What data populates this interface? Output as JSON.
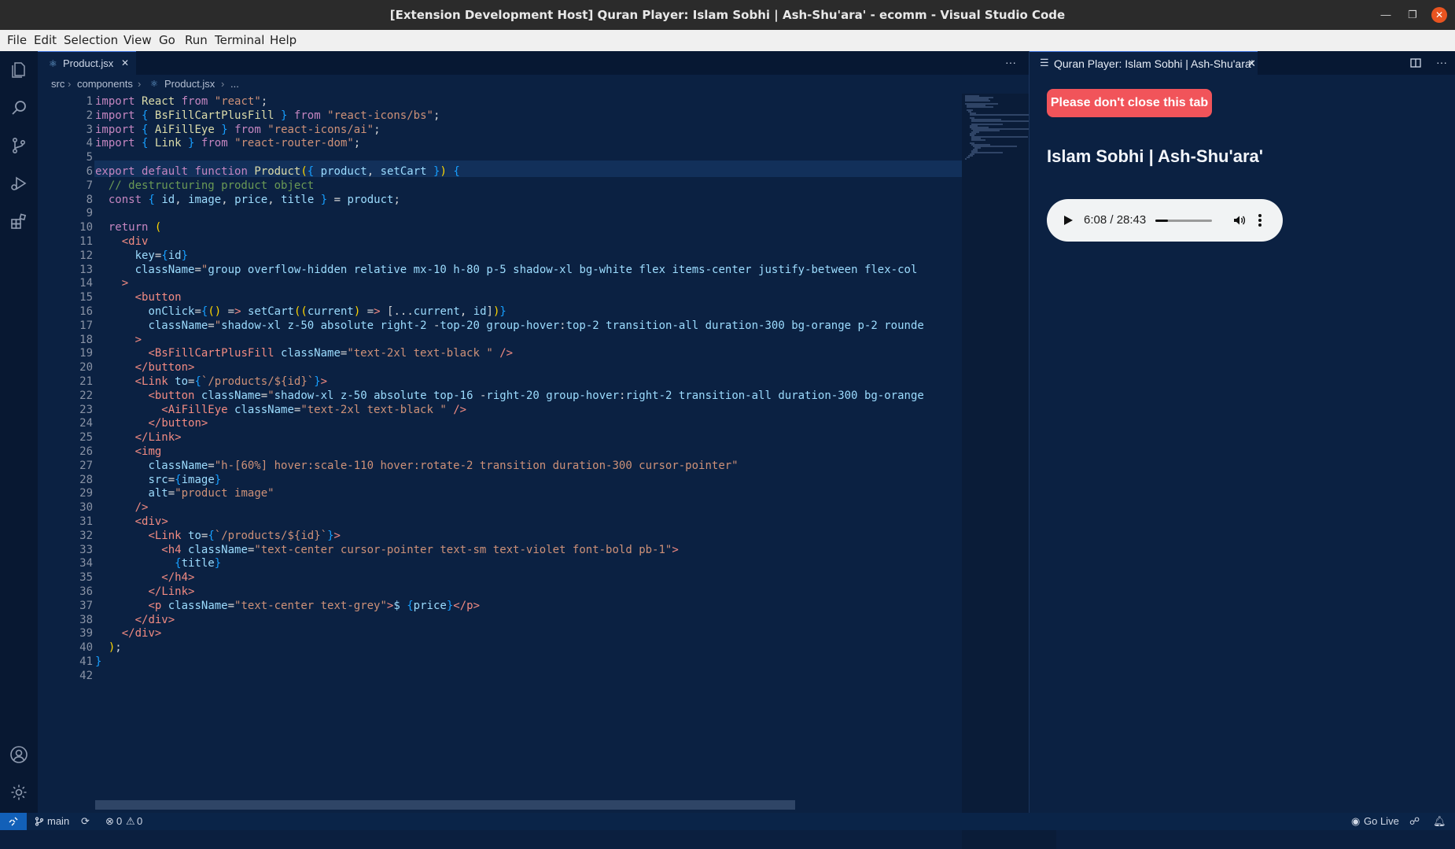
{
  "window": {
    "title": "[Extension Development Host] Quran Player: Islam Sobhi | Ash-Shu'ara' - ecomm - Visual Studio Code"
  },
  "menu": [
    "File",
    "Edit",
    "Selection",
    "View",
    "Go",
    "Run",
    "Terminal",
    "Help"
  ],
  "activity_icons": [
    "explorer-icon",
    "search-icon",
    "source-control-icon",
    "run-debug-icon",
    "extensions-icon",
    "accounts-icon",
    "manage-gear-icon"
  ],
  "editor": {
    "tab_label": "Product.jsx",
    "more_label": "···",
    "breadcrumbs": [
      "src",
      "components",
      "Product.jsx",
      "..."
    ],
    "lines": [
      "import React from \"react\";",
      "import { BsFillCartPlusFill } from \"react-icons/bs\";",
      "import { AiFillEye } from \"react-icons/ai\";",
      "import { Link } from \"react-router-dom\";",
      "",
      "export default function Product({ product, setCart }) {",
      "  // destructuring product object",
      "  const { id, image, price, title } = product;",
      "",
      "  return (",
      "    <div",
      "      key={id}",
      "      className=\"group overflow-hidden relative mx-10 h-80 p-5 shadow-xl bg-white flex items-center justify-between flex-col",
      "    >",
      "      <button",
      "        onClick={() => setCart((current) => [...current, id])}",
      "        className=\"shadow-xl z-50 absolute right-2 -top-20 group-hover:top-2 transition-all duration-300 bg-orange p-2 rounde",
      "      >",
      "        <BsFillCartPlusFill className=\"text-2xl text-black \" />",
      "      </button>",
      "      <Link to={`/products/${id}`}>",
      "        <button className=\"shadow-xl z-50 absolute top-16 -right-20 group-hover:right-2 transition-all duration-300 bg-orange",
      "          <AiFillEye className=\"text-2xl text-black \" />",
      "        </button>",
      "      </Link>",
      "      <img",
      "        className=\"h-[60%] hover:scale-110 hover:rotate-2 transition duration-300 cursor-pointer\"",
      "        src={image}",
      "        alt=\"product image\"",
      "      />",
      "      <div>",
      "        <Link to={`/products/${id}`}>",
      "          <h4 className=\"text-center cursor-pointer text-sm text-violet font-bold pb-1\">",
      "            {title}",
      "          </h4>",
      "        </Link>",
      "        <p className=\"text-center text-grey\">$ {price}</p>",
      "      </div>",
      "    </div>",
      "  );",
      "}",
      ""
    ]
  },
  "panel": {
    "tab_label": "Quran Player: Islam Sobhi | Ash-Shu'ara'",
    "warning_button": "Please don't close this tab",
    "track_title": "Islam Sobhi | Ash-Shu'ara'",
    "audio": {
      "time": "6:08 / 28:43",
      "progress": 0.216
    }
  },
  "status": {
    "branch": "main",
    "errors": "0",
    "warnings": "0",
    "go_live": "Go Live"
  },
  "colors": {
    "editor_bg": "#0b2142",
    "accent": "#3a6fd9",
    "warning_button": "#f1545a"
  }
}
